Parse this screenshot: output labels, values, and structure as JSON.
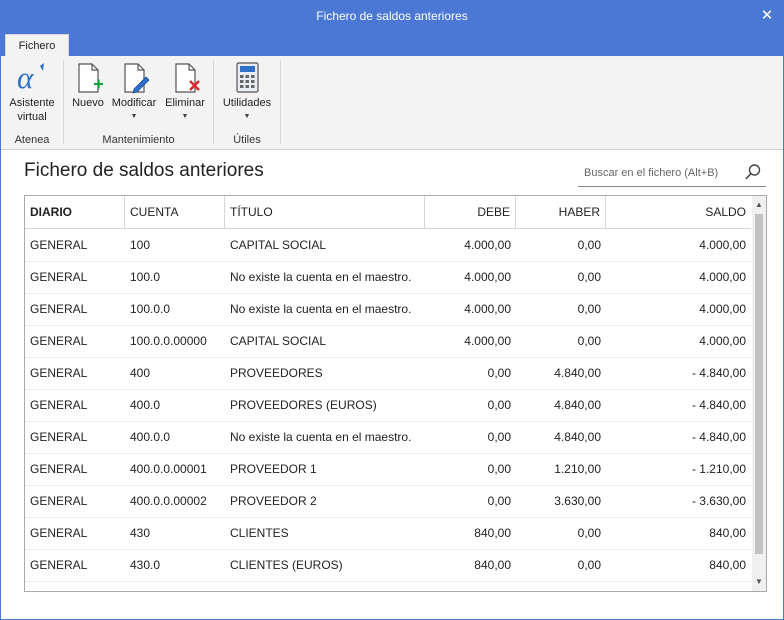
{
  "window": {
    "title": "Fichero de saldos anteriores",
    "close_glyph": "✕"
  },
  "tabs": [
    {
      "label": "Fichero",
      "active": true
    }
  ],
  "ribbon": {
    "groups": [
      {
        "label": "Atenea",
        "buttons": [
          {
            "label_line1": "Asistente",
            "label_line2": "virtual",
            "icon": "assistant-alpha-icon"
          }
        ]
      },
      {
        "label": "Mantenimiento",
        "buttons": [
          {
            "label": "Nuevo",
            "icon": "new-document-icon",
            "dropdown": false
          },
          {
            "label": "Modificar",
            "icon": "edit-document-icon",
            "dropdown": true
          },
          {
            "label": "Eliminar",
            "icon": "delete-document-icon",
            "dropdown": true
          }
        ]
      },
      {
        "label": "Útiles",
        "buttons": [
          {
            "label": "Utilidades",
            "icon": "calculator-icon",
            "dropdown": true
          }
        ]
      }
    ]
  },
  "page": {
    "title": "Fichero de saldos anteriores"
  },
  "search": {
    "placeholder": "Buscar en el fichero (Alt+B)",
    "value": ""
  },
  "table": {
    "columns": [
      "DIARIO",
      "CUENTA",
      "TÍTULO",
      "DEBE",
      "HABER",
      "SALDO"
    ],
    "rows": [
      [
        "GENERAL",
        "100",
        "CAPITAL SOCIAL",
        "4.000,00",
        "0,00",
        "4.000,00"
      ],
      [
        "GENERAL",
        "100.0",
        "No existe la cuenta en el maestro.",
        "4.000,00",
        "0,00",
        "4.000,00"
      ],
      [
        "GENERAL",
        "100.0.0",
        "No existe la cuenta en el maestro.",
        "4.000,00",
        "0,00",
        "4.000,00"
      ],
      [
        "GENERAL",
        "100.0.0.00000",
        "CAPITAL SOCIAL",
        "4.000,00",
        "0,00",
        "4.000,00"
      ],
      [
        "GENERAL",
        "400",
        "PROVEEDORES",
        "0,00",
        "4.840,00",
        "- 4.840,00"
      ],
      [
        "GENERAL",
        "400.0",
        "PROVEEDORES (EUROS)",
        "0,00",
        "4.840,00",
        "- 4.840,00"
      ],
      [
        "GENERAL",
        "400.0.0",
        "No existe la cuenta en el maestro.",
        "0,00",
        "4.840,00",
        "- 4.840,00"
      ],
      [
        "GENERAL",
        "400.0.0.00001",
        "PROVEEDOR 1",
        "0,00",
        "1.210,00",
        "- 1.210,00"
      ],
      [
        "GENERAL",
        "400.0.0.00002",
        "PROVEEDOR 2",
        "0,00",
        "3.630,00",
        "- 3.630,00"
      ],
      [
        "GENERAL",
        "430",
        "CLIENTES",
        "840,00",
        "0,00",
        "840,00"
      ],
      [
        "GENERAL",
        "430.0",
        "CLIENTES (EUROS)",
        "840,00",
        "0,00",
        "840,00"
      ]
    ]
  },
  "colors": {
    "titlebar": "#4a78d4",
    "ribbon_bg": "#f3f3f3",
    "accent_green": "#1a9e3c",
    "accent_red": "#d9262c",
    "accent_blue": "#2f6fc6"
  }
}
